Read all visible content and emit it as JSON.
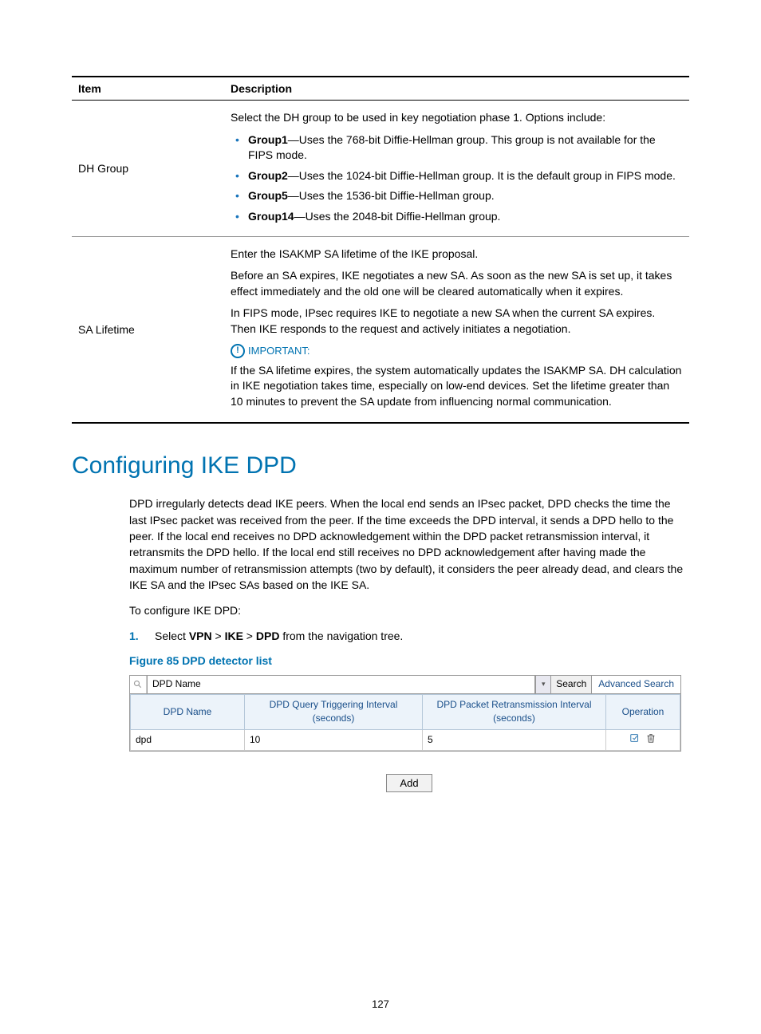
{
  "table": {
    "headers": {
      "item": "Item",
      "description": "Description"
    },
    "rows": [
      {
        "item": "DH Group",
        "intro": "Select the DH group to be used in key negotiation phase 1. Options include:",
        "bullets": [
          {
            "label": "Group1",
            "text": "—Uses the 768-bit Diffie-Hellman group. This group is not available for the FIPS mode."
          },
          {
            "label": "Group2",
            "text": "—Uses the 1024-bit Diffie-Hellman group. It is the default group in FIPS mode."
          },
          {
            "label": "Group5",
            "text": "—Uses the 1536-bit Diffie-Hellman group."
          },
          {
            "label": "Group14",
            "text": "—Uses the 2048-bit Diffie-Hellman group."
          }
        ]
      },
      {
        "item": "SA Lifetime",
        "p1": "Enter the ISAKMP SA lifetime of the IKE proposal.",
        "p2": "Before an SA expires, IKE negotiates a new SA. As soon as the new SA is set up, it takes effect immediately and the old one will be cleared automatically when it expires.",
        "p3": "In FIPS mode, IPsec requires IKE to negotiate a new SA when the current SA expires. Then IKE responds to the request and actively initiates a negotiation.",
        "important_label": "IMPORTANT:",
        "important_text": "If the SA lifetime expires, the system automatically updates the ISAKMP SA. DH calculation in IKE negotiation takes time, especially on low-end devices. Set the lifetime greater than 10 minutes to prevent the SA update from influencing normal communication."
      }
    ]
  },
  "heading": "Configuring IKE DPD",
  "para1": "DPD irregularly detects dead IKE peers. When the local end sends an IPsec packet, DPD checks the time the last IPsec packet was received from the peer. If the time exceeds the DPD interval, it sends a DPD hello to the peer. If the local end receives no DPD acknowledgement within the DPD packet retransmission interval, it retransmits the DPD hello. If the local end still receives no DPD acknowledgement after having made the maximum number of retransmission attempts (two by default), it considers the peer already dead, and clears the IKE SA and the IPsec SAs based on the IKE SA.",
  "para2": "To configure IKE DPD:",
  "step1": {
    "num": "1.",
    "pre": "Select ",
    "b1": "VPN",
    "sep1": " > ",
    "b2": "IKE",
    "sep2": " > ",
    "b3": "DPD",
    "post": " from the navigation tree."
  },
  "figure_caption": "Figure 85 DPD detector list",
  "figure": {
    "search_label": "DPD Name",
    "search_button": "Search",
    "advanced": "Advanced Search",
    "cols": {
      "c1": "DPD Name",
      "c2": "DPD Query Triggering Interval (seconds)",
      "c3": "DPD Packet Retransmission Interval (seconds)",
      "c4": "Operation"
    },
    "row": {
      "name": "dpd",
      "q": "10",
      "r": "5"
    },
    "add": "Add"
  },
  "page_num": "127"
}
